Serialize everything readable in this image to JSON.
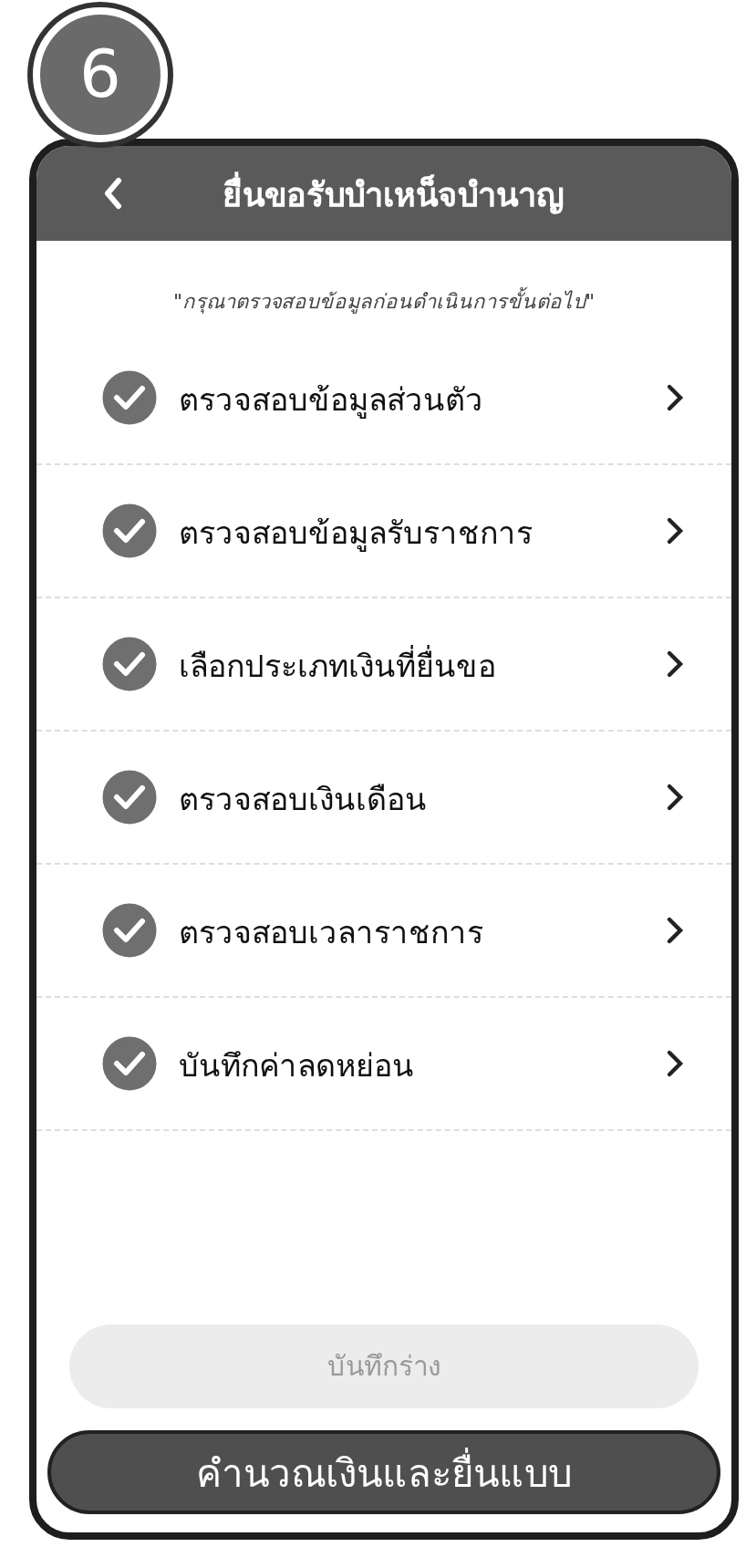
{
  "step_badge": "6",
  "header": {
    "title": "ยื่นขอรับบำเหน็จบำนาญ"
  },
  "notice": "\"กรุณาตรวจสอบข้อมูลก่อนดำเนินการขั้นต่อไป\"",
  "steps": [
    {
      "label": "ตรวจสอบข้อมูลส่วนตัว",
      "checked": true
    },
    {
      "label": "ตรวจสอบข้อมูลรับราชการ",
      "checked": true
    },
    {
      "label": "เลือกประเภทเงินที่ยื่นขอ",
      "checked": true
    },
    {
      "label": "ตรวจสอบเงินเดือน",
      "checked": true
    },
    {
      "label": "ตรวจสอบเวลาราชการ",
      "checked": true
    },
    {
      "label": "บันทึกค่าลดหย่อน",
      "checked": true
    }
  ],
  "buttons": [
    {
      "label": "บันทึกร่าง",
      "disabled": true
    },
    {
      "label": "คำนวณเงินและยื่นแบบ",
      "disabled": false
    }
  ]
}
